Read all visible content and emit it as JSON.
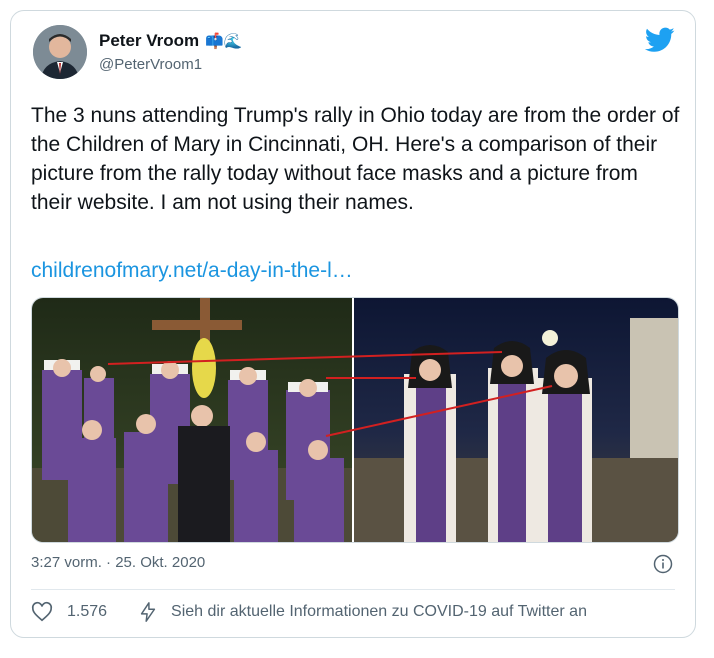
{
  "author": {
    "name": "Peter Vroom",
    "emojis": "📫🌊",
    "handle": "@PeterVroom1"
  },
  "tweet": {
    "text": "The 3 nuns attending Trump's rally in Ohio today are from the order of the Children of Mary in Cincinnati, OH. Here's a comparison of their picture from the rally today without face masks and a picture from their website. I am not using their names.",
    "link": "childrenofmary.net/a-day-in-the-l…",
    "timestamp": "3:27 vorm. · 25. Okt. 2020"
  },
  "actions": {
    "like_count": "1.576",
    "covid_notice": "Sieh dir aktuelle Informationen zu COVID-19 auf Twitter an"
  },
  "colors": {
    "link": "#1b95e0",
    "twitter_blue": "#1da1f2",
    "muted": "#536471"
  },
  "icons": [
    "twitter-bird-icon",
    "info-icon",
    "heart-icon",
    "lightning-icon"
  ]
}
